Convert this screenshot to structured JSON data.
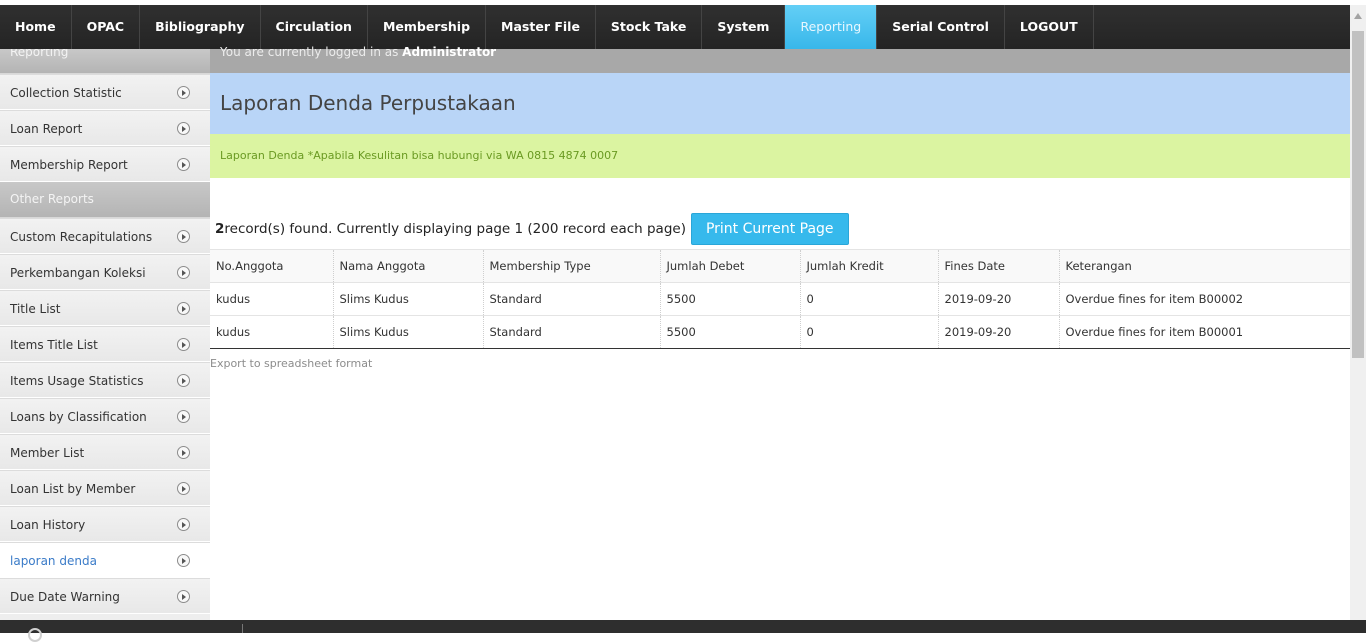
{
  "nav": [
    {
      "label": "Home"
    },
    {
      "label": "OPAC"
    },
    {
      "label": "Bibliography"
    },
    {
      "label": "Circulation"
    },
    {
      "label": "Membership"
    },
    {
      "label": "Master File"
    },
    {
      "label": "Stock Take"
    },
    {
      "label": "System"
    },
    {
      "label": "Reporting"
    },
    {
      "label": "Serial Control"
    },
    {
      "label": "LOGOUT"
    }
  ],
  "sidebar": {
    "header1": "Reporting",
    "group1": [
      "Collection Statistic",
      "Loan Report",
      "Membership Report"
    ],
    "header2": "Other Reports",
    "group2": [
      "Custom Recapitulations",
      "Perkembangan Koleksi",
      "Title List",
      "Items Title List",
      "Items Usage Statistics",
      "Loans by Classification",
      "Member List",
      "Loan List by Member",
      "Loan History",
      "laporan denda",
      "Due Date Warning"
    ]
  },
  "login": {
    "prefix": "You are currently logged in as ",
    "user": "Administrator"
  },
  "page": {
    "title": "Laporan Denda Perpustakaan",
    "info": "Laporan Denda *Apabila Kesulitan bisa hubungi via WA 0815 4874 0007",
    "record_count": "2",
    "record_text": " record(s) found. Currently displaying page 1 (200 record each page)",
    "print_label": "Print Current Page",
    "export_label": "Export to spreadsheet format"
  },
  "table": {
    "headers": [
      "No.Anggota",
      "Nama Anggota",
      "Membership Type",
      "Jumlah Debet",
      "Jumlah Kredit",
      "Fines Date",
      "Keterangan"
    ],
    "rows": [
      [
        "kudus",
        "Slims Kudus",
        "Standard",
        "5500",
        "0",
        "2019-09-20",
        "Overdue fines for item B00002"
      ],
      [
        "kudus",
        "Slims Kudus",
        "Standard",
        "5500",
        "0",
        "2019-09-20",
        "Overdue fines for item B00001"
      ]
    ]
  }
}
